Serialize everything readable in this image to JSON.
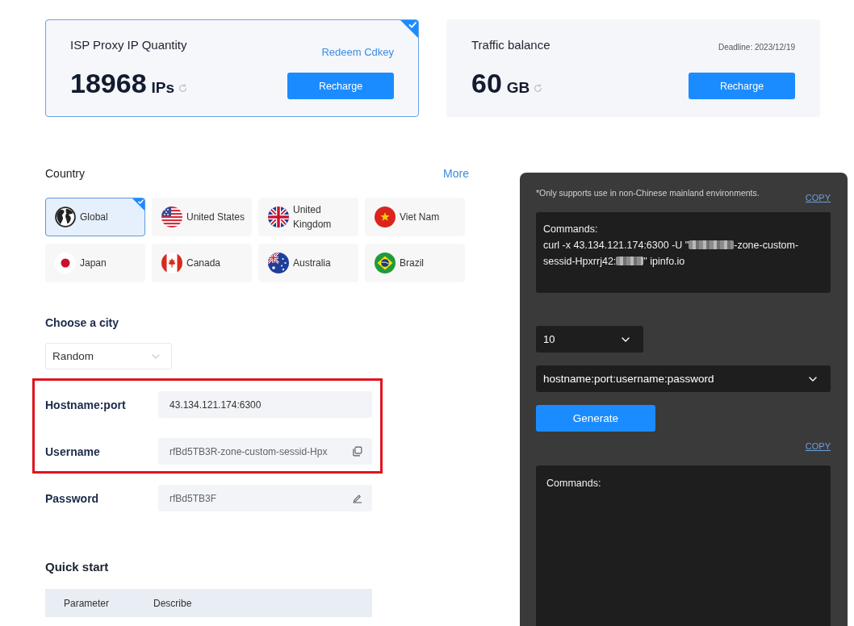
{
  "balance_cards": [
    {
      "title": "ISP Proxy IP Quantity",
      "amount": "18968",
      "unit": "IPs",
      "action_link": "Redeem Cdkey",
      "button": "Recharge",
      "selected": true
    },
    {
      "title": "Traffic balance",
      "amount": "60",
      "unit": "GB",
      "deadline": "Deadline: 2023/12/19",
      "button": "Recharge",
      "selected": false
    }
  ],
  "country": {
    "label": "Country",
    "more_link": "More",
    "options": [
      {
        "name": "Global",
        "selected": true
      },
      {
        "name": "United States",
        "selected": false
      },
      {
        "name": "United Kingdom",
        "selected": false
      },
      {
        "name": "Viet Nam",
        "selected": false
      },
      {
        "name": "Japan",
        "selected": false
      },
      {
        "name": "Canada",
        "selected": false
      },
      {
        "name": "Australia",
        "selected": false
      },
      {
        "name": "Brazil",
        "selected": false
      }
    ]
  },
  "city": {
    "label": "Choose a city",
    "value": "Random"
  },
  "credentials": [
    {
      "kind": "plain",
      "label": "Hostname:port",
      "value": "43.134.121.174:6300",
      "blurred": false,
      "highlighted": true
    },
    {
      "kind": "copy",
      "label": "Username",
      "value": "rfBd5TB3R-zone-custom-sessid-Hpx",
      "blurred": true,
      "highlighted": true
    },
    {
      "kind": "edit",
      "label": "Password",
      "value": "rfBd5TB3F",
      "blurred": true,
      "highlighted": false
    }
  ],
  "quick_start": {
    "title": "Quick start",
    "table": {
      "columns": [
        "Parameter",
        "Describe"
      ]
    }
  },
  "api_panel": {
    "notice": "*Only supports use in non-Chinese mainland environments.",
    "copy_link": "COPY",
    "command_box": {
      "label": "Commands:",
      "segments": [
        {
          "kind": "text",
          "text": "curl -x 43.134.121.174:6300 -U \""
        },
        {
          "kind": "redacted"
        },
        {
          "kind": "text",
          "text": "-zone-custom-"
        },
        {
          "kind": "text",
          "text": "sessid-Hpxrrj42:"
        },
        {
          "kind": "redacted"
        },
        {
          "kind": "text",
          "text": "\" ipinfo.io"
        }
      ]
    },
    "count_select": {
      "value": "10"
    },
    "format_select": {
      "value": "hostname:port:username:password"
    },
    "generate_button": "Generate",
    "output_copy_link": "COPY",
    "output_box": {
      "label": "Commands:"
    }
  }
}
